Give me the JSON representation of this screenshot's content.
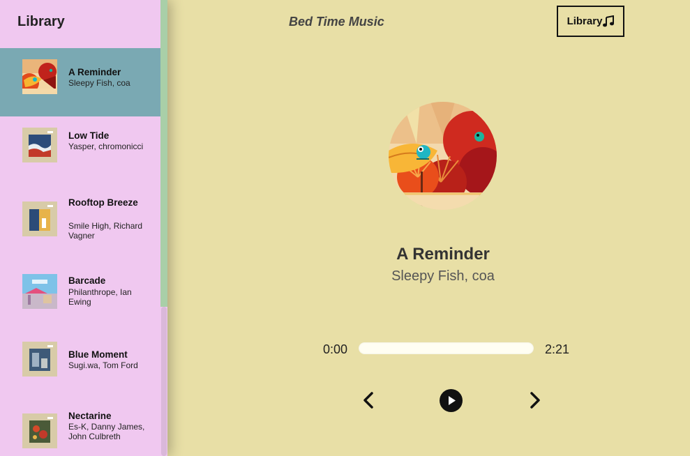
{
  "sidebar": {
    "title": "Library",
    "songs": [
      {
        "name": "A Reminder",
        "artist": "Sleepy Fish, coa",
        "selected": true
      },
      {
        "name": "Low Tide",
        "artist": "Yasper, chromonicci",
        "selected": false
      },
      {
        "name": "Rooftop Breeze",
        "artist": "Smile High, Richard Vagner",
        "selected": false
      },
      {
        "name": "Barcade",
        "artist": "Philanthrope, Ian Ewing",
        "selected": false
      },
      {
        "name": "Blue Moment",
        "artist": "Sugi.wa, Tom Ford",
        "selected": false
      },
      {
        "name": "Nectarine",
        "artist": "Es-K, Danny James, John Culbreth",
        "selected": false
      }
    ]
  },
  "header": {
    "title": "Bed Time Music",
    "library_button": "Library",
    "library_icon": "music-note-icon"
  },
  "player": {
    "title": "A Reminder",
    "artist": "Sleepy Fish, coa",
    "current_time": "0:00",
    "duration": "2:21",
    "progress": 0
  },
  "icons": {
    "prev": "chevron-left-icon",
    "play": "play-icon",
    "next": "chevron-right-icon"
  },
  "colors": {
    "background": "#e8dfa6",
    "sidebar": "#f0c8f0",
    "selected_row": "#7aa9b3",
    "scroll_thumb": "#a9cfa8"
  }
}
